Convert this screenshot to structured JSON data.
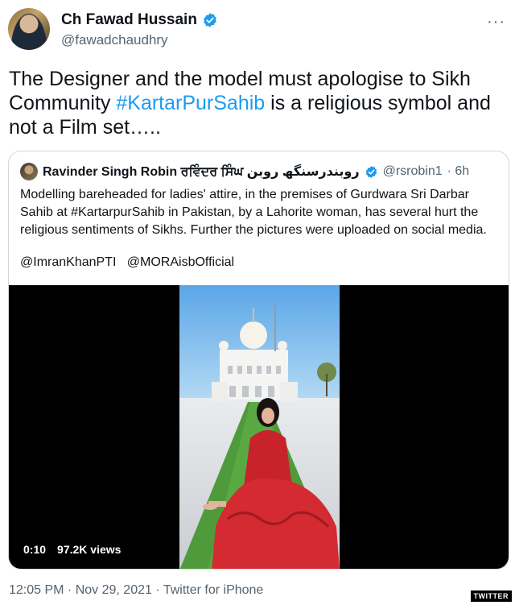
{
  "tweet": {
    "author": {
      "display_name": "Ch Fawad Hussain",
      "handle": "@fawadchaudhry",
      "verified_icon": "verified-badge-icon"
    },
    "more_icon": "more-icon",
    "more_label": "···",
    "text_before": "The Designer and the model must apologise to Sikh Community ",
    "hashtag": "#KartarPurSahib",
    "text_after": " is a religious symbol and not a Film set…..",
    "footer": {
      "time": "12:05 PM",
      "sep1": " · ",
      "date": "Nov 29, 2021",
      "sep2": " · ",
      "source": "Twitter for iPhone"
    }
  },
  "quote": {
    "author": {
      "display_name": "Ravinder Singh Robin ਰਵਿੰਦਰ ਸਿੰਘ روبندرسنگھ روبن",
      "handle": "@rsrobin1",
      "time": "· 6h"
    },
    "text_part1": "Modelling bareheaded for ladies' attire, in the premises  of Gurdwara Sri Darbar Sahib at ",
    "hashtag": "#KartarpurSahib",
    "text_part2": " in Pakistan, by a Lahorite woman,  has several hurt the religious sentiments of Sikhs. Further the pictures were uploaded on social media.",
    "mention1": "@ImranKhanPTI",
    "mention2": "@MORAisbOfficial",
    "video": {
      "duration": "0:10",
      "views": "97.2K views"
    }
  },
  "watermark": "TWITTER",
  "colors": {
    "accent": "#1d9bf0",
    "text": "#0f1419",
    "muted": "#536471",
    "border": "#cfd9de"
  }
}
